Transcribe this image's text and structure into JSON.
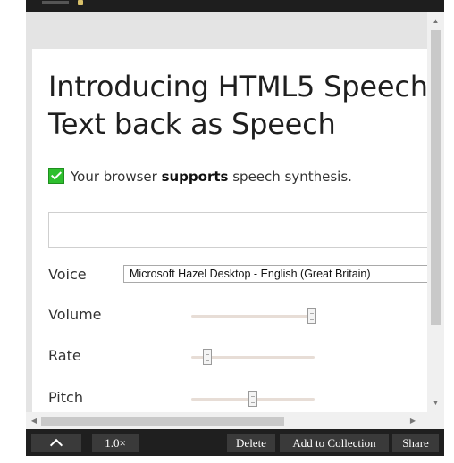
{
  "page": {
    "title_lines": [
      "Introducing HTML5 Speech",
      "Text back as Speech"
    ],
    "support": {
      "prefix": "Your browser ",
      "emphasis": "supports",
      "suffix": " speech synthesis."
    },
    "text_input_value": "",
    "voice": {
      "label": "Voice",
      "selected": "Microsoft Hazel Desktop - English (Great Britain)"
    },
    "sliders": [
      {
        "label": "Volume",
        "value": 0.98
      },
      {
        "label": "Rate",
        "value": 0.13
      },
      {
        "label": "Pitch",
        "value": 0.5
      }
    ]
  },
  "toolbar": {
    "zoom_label": "1.0×",
    "delete_label": "Delete",
    "add_label": "Add to Collection",
    "share_label": "Share"
  },
  "icons": {
    "collapse": "chevron-up-icon",
    "scroll_up": "arrow-up-icon",
    "scroll_down": "arrow-down-icon",
    "scroll_left": "arrow-left-icon",
    "scroll_right": "arrow-right-icon",
    "supported": "check-icon"
  },
  "colors": {
    "toolbar_bg": "#1f1f1f",
    "button_bg": "#3a3a3a",
    "check_green": "#2ebf2e"
  }
}
